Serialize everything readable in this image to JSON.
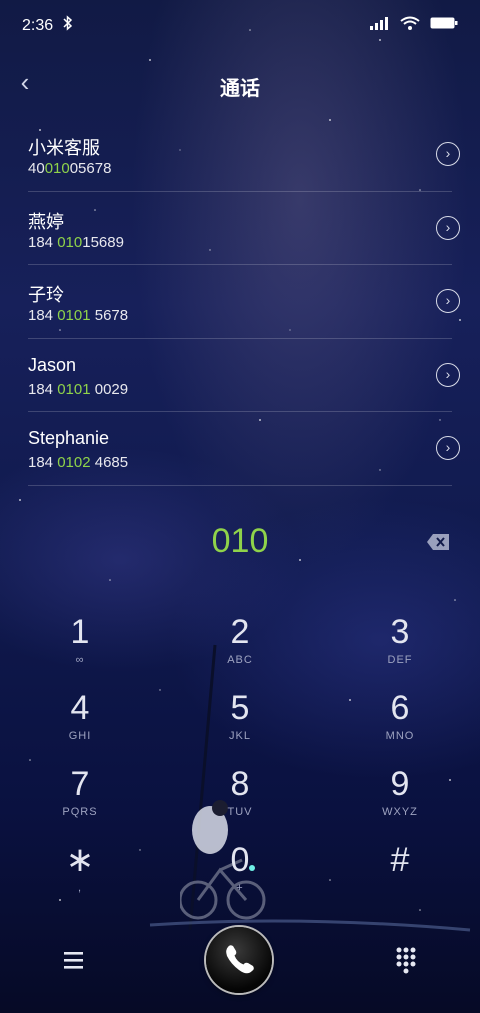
{
  "status": {
    "time": "2:36",
    "bluetooth_icon": "bluetooth-icon",
    "signal_icon": "signal-icon",
    "wifi_icon": "wifi-icon",
    "battery_icon": "battery-icon"
  },
  "header": {
    "back_icon": "chevron-left-icon",
    "back_glyph": "‹",
    "title": "通话"
  },
  "contacts": [
    {
      "name": "小米客服",
      "number_pre": "40",
      "number_hl": "010",
      "number_post": "05678"
    },
    {
      "name": "燕婷",
      "number_pre": "184 ",
      "number_hl": "010",
      "number_post": "15689"
    },
    {
      "name": "子玲",
      "number_pre": "184 ",
      "number_hl": "0101",
      "number_post": " 5678"
    },
    {
      "name": "Jason",
      "number_pre": "184 ",
      "number_hl": "0101",
      "number_post": " 0029"
    },
    {
      "name": "Stephanie",
      "number_pre": "184 ",
      "number_hl": "0102",
      "number_post": " 4685"
    }
  ],
  "detail_glyph": "›",
  "dialer": {
    "input": "010",
    "delete_icon": "backspace-icon"
  },
  "keypad": [
    {
      "digit": "1",
      "sub": "∞"
    },
    {
      "digit": "2",
      "sub": "ABC"
    },
    {
      "digit": "3",
      "sub": "DEF"
    },
    {
      "digit": "4",
      "sub": "GHI"
    },
    {
      "digit": "5",
      "sub": "JKL"
    },
    {
      "digit": "6",
      "sub": "MNO"
    },
    {
      "digit": "7",
      "sub": "PQRS"
    },
    {
      "digit": "8",
      "sub": "TUV"
    },
    {
      "digit": "9",
      "sub": "WXYZ"
    },
    {
      "digit": "∗",
      "sub": ","
    },
    {
      "digit": "0",
      "sub": "+"
    },
    {
      "digit": "#",
      "sub": ""
    }
  ],
  "bottom": {
    "menu_icon": "menu-icon",
    "call_icon": "phone-icon",
    "keypad_icon": "dialpad-icon"
  },
  "colors": {
    "highlight": "#8fd34a",
    "background": "#111a48"
  }
}
